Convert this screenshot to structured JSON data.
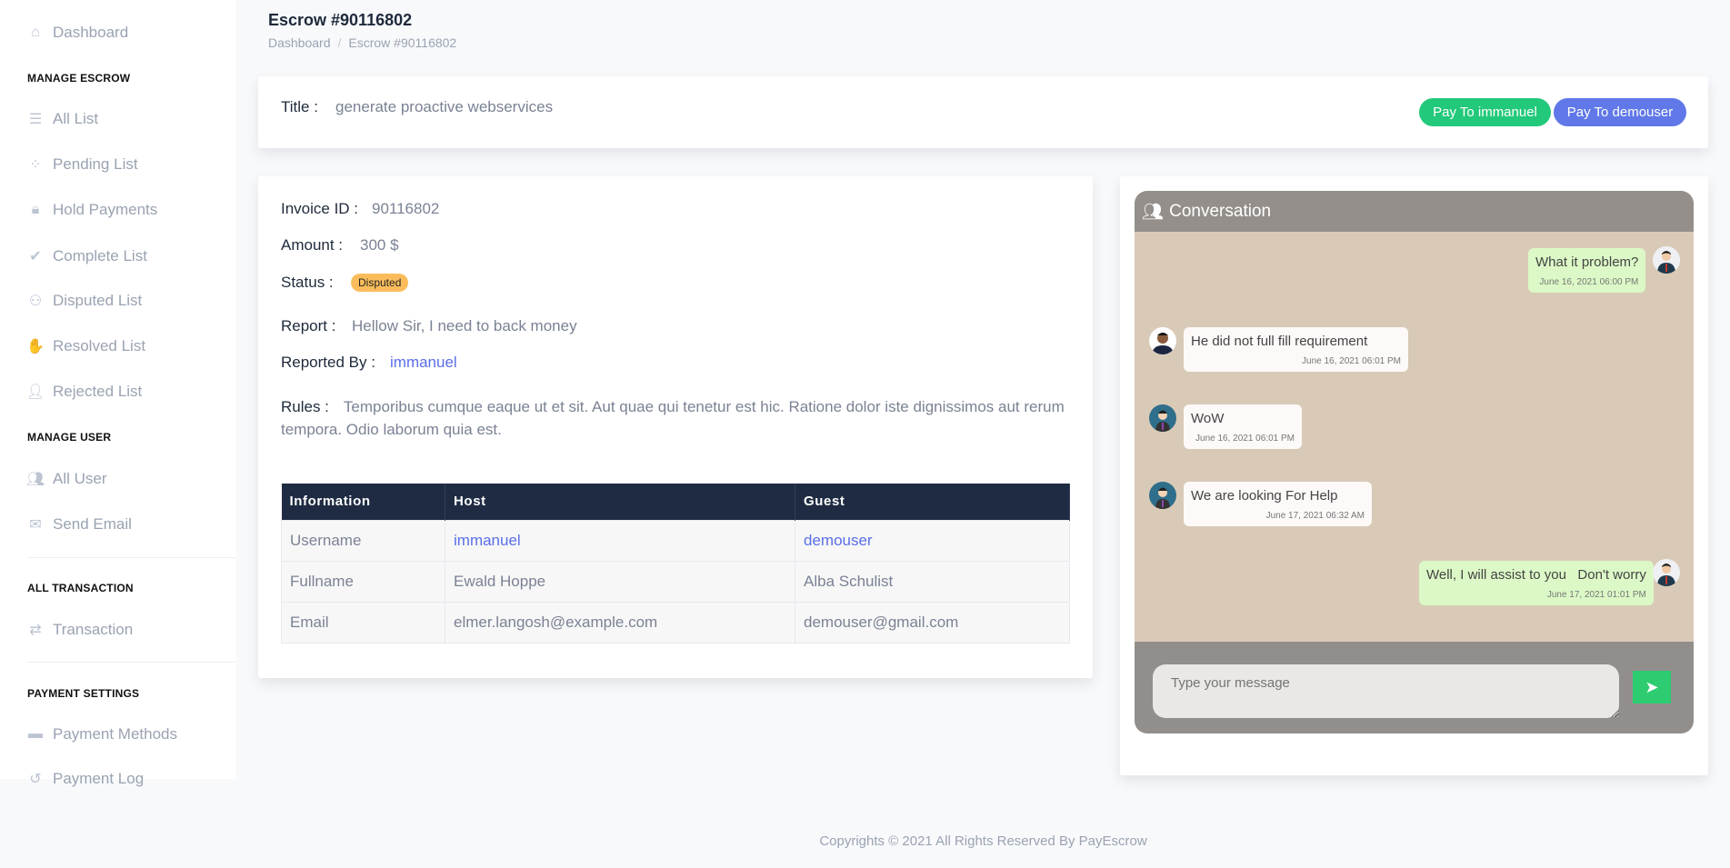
{
  "sidebar": {
    "dashboard": "Dashboard",
    "sections": [
      {
        "heading": "MANAGE ESCROW",
        "items": [
          "All List",
          "Pending List",
          "Hold Payments",
          "Complete List",
          "Disputed List",
          "Resolved List",
          "Rejected List"
        ]
      },
      {
        "heading": "MANAGE USER",
        "items": [
          "All User",
          "Send Email"
        ]
      },
      {
        "heading": "ALL TRANSACTION",
        "items": [
          "Transaction"
        ]
      },
      {
        "heading": "PAYMENT SETTINGS",
        "items": [
          "Payment Methods",
          "Payment Log"
        ]
      }
    ]
  },
  "header": {
    "title": "Escrow #90116802",
    "breadcrumb": [
      "Dashboard",
      "Escrow #90116802"
    ]
  },
  "title_card": {
    "label": "Title :",
    "value": "generate proactive webservices",
    "pay_host": "Pay To immanuel",
    "pay_guest": "Pay To demouser"
  },
  "details": {
    "invoice_label": "Invoice ID :",
    "invoice": "90116802",
    "amount_label": "Amount :",
    "amount": "300 $",
    "status_label": "Status :",
    "status": "Disputed",
    "report_label": "Report :",
    "report": "Hellow Sir, I need to back money",
    "reported_by_label": "Reported By :",
    "reported_by": "immanuel",
    "rules_label": "Rules :",
    "rules": "Temporibus cumque eaque ut et sit. Aut quae qui tenetur est hic. Ratione dolor iste dignissimos aut rerum tempora. Odio laborum quia est."
  },
  "table": {
    "headers": [
      "Information",
      "Host",
      "Guest"
    ],
    "rows": [
      [
        "Username",
        "immanuel",
        "demouser"
      ],
      [
        "Fullname",
        "Ewald Hoppe",
        "Alba Schulist"
      ],
      [
        "Email",
        "elmer.langosh@example.com",
        "demouser@gmail.com"
      ]
    ]
  },
  "chat": {
    "title": "Conversation",
    "messages": [
      {
        "text": "What it problem?",
        "time": "June 16, 2021 06:00 PM",
        "side": "right"
      },
      {
        "text": "He did not full fill requirement",
        "time": "June 16, 2021 06:01 PM",
        "side": "left"
      },
      {
        "text": "WoW",
        "time": "June 16, 2021 06:01 PM",
        "side": "left"
      },
      {
        "text": "We are looking For Help",
        "time": "June 17, 2021 06:32 AM",
        "side": "left"
      },
      {
        "text": "Well, I will assist to you   Don't worry",
        "time": "June 17, 2021 01:01 PM",
        "side": "right"
      }
    ],
    "placeholder": "Type your message"
  },
  "footer": "Copyrights © 2021 All Rights Reserved By PayEscrow",
  "colors": {
    "green": "#22c97a",
    "blue": "#6078e8",
    "status": "#fbbd5c",
    "table_head": "#1e2b42"
  }
}
